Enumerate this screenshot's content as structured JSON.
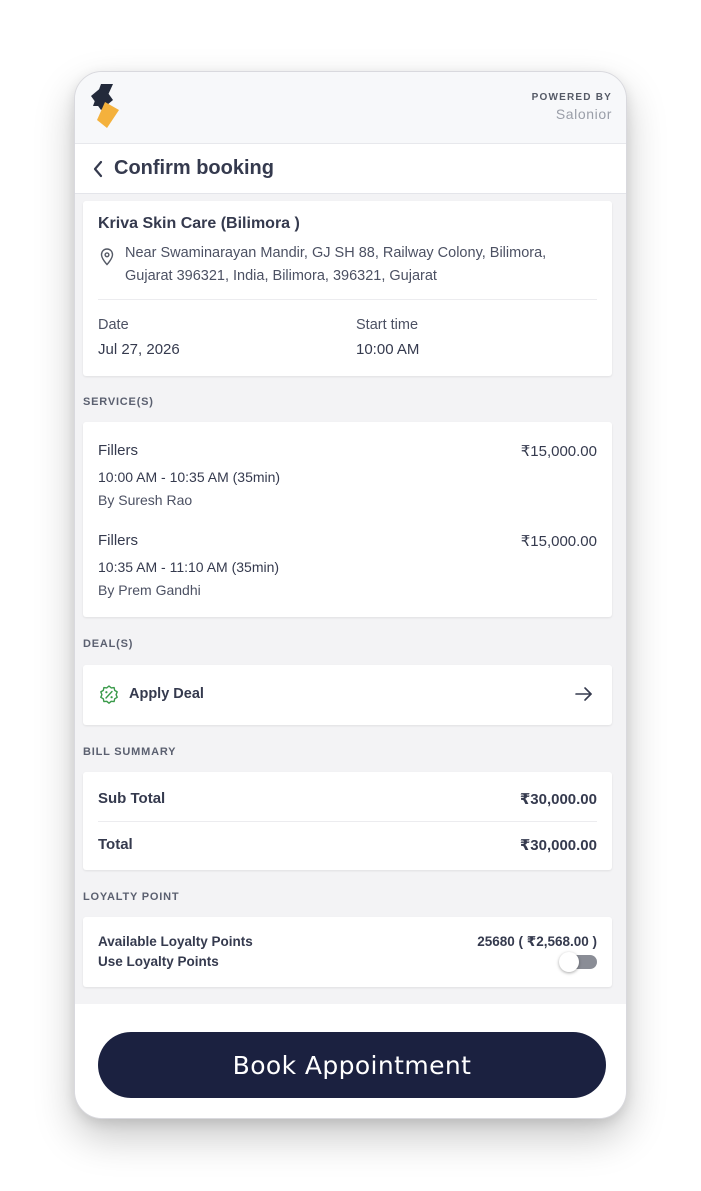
{
  "header": {
    "powered_label": "POWERED BY",
    "powered_brand": "Salonior",
    "logo_colors": {
      "dark": "#232a3b",
      "accent": "#f4b13c"
    }
  },
  "nav": {
    "back_icon": "chevron-left-icon",
    "title": "Confirm booking"
  },
  "salon": {
    "name": "Kriva Skin Care (Bilimora )",
    "address": "Near Swaminarayan Mandir, GJ SH 88, Railway Colony, Bilimora, Gujarat 396321, India, Bilimora, 396321, Gujarat",
    "date_label": "Date",
    "date_value": "Jul 27, 2026",
    "time_label": "Start time",
    "time_value": "10:00 AM"
  },
  "services": {
    "heading": "SERVICE(S)",
    "items": [
      {
        "name": "Fillers",
        "price": "₹15,000.00",
        "time": "10:00 AM - 10:35 AM (35min)",
        "by": "By Suresh Rao"
      },
      {
        "name": "Fillers",
        "price": "₹15,000.00",
        "time": "10:35 AM - 11:10 AM (35min)",
        "by": "By Prem Gandhi"
      }
    ]
  },
  "deals": {
    "heading": "DEAL(S)",
    "apply_label": "Apply Deal",
    "icon": "discount-badge-icon",
    "arrow_icon": "arrow-right-icon",
    "icon_color": "#3a9a4a"
  },
  "bill": {
    "heading": "BILL SUMMARY",
    "subtotal_label": "Sub Total",
    "subtotal_value": "₹30,000.00",
    "total_label": "Total",
    "total_value": "₹30,000.00"
  },
  "loyalty": {
    "heading": "LOYALTY POINT",
    "available_label": "Available Loyalty Points",
    "available_value": "25680 ( ₹2,568.00 )",
    "use_label": "Use Loyalty Points",
    "use_enabled": false
  },
  "footer": {
    "book_label": "Book Appointment",
    "button_color": "#1b2140"
  }
}
